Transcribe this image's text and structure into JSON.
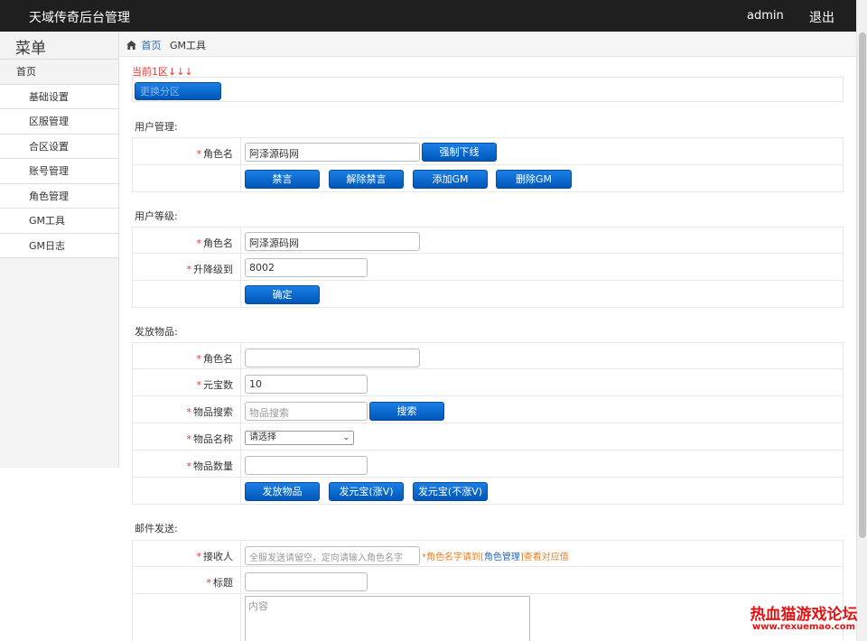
{
  "header": {
    "title": "天域传奇后台管理",
    "user": "admin",
    "logout": "退出"
  },
  "sidebar": {
    "title": "菜单",
    "items": [
      {
        "label": "首页",
        "type": "root"
      },
      {
        "label": "基础设置",
        "type": "sub"
      },
      {
        "label": "区服管理",
        "type": "sub"
      },
      {
        "label": "合区设置",
        "type": "sub"
      },
      {
        "label": "账号管理",
        "type": "sub"
      },
      {
        "label": "角色管理",
        "type": "sub"
      },
      {
        "label": "GM工具",
        "type": "sub"
      },
      {
        "label": "GM日志",
        "type": "sub"
      }
    ]
  },
  "breadcrumb": {
    "home": "首页",
    "current": "GM工具"
  },
  "zone": {
    "current_label": "当前1区",
    "arrows": "↓↓↓",
    "switch_button": "更换分区"
  },
  "user_mgmt": {
    "title": "用户管理:",
    "role_label": "角色名",
    "role_value": "阿泽源码网",
    "kick_button": "强制下线",
    "buttons": {
      "mute": "禁言",
      "unmute": "解除禁言",
      "add_gm": "添加GM",
      "remove_gm": "删除GM"
    }
  },
  "user_level": {
    "title": "用户等级:",
    "role_label": "角色名",
    "role_value": "阿泽源码网",
    "level_label": "升降级到",
    "level_value": "8002",
    "confirm_button": "确定"
  },
  "items": {
    "title": "发放物品:",
    "role_label": "角色名",
    "role_value": "",
    "yuanbao_label": "元宝数",
    "yuanbao_value": "10",
    "search_label": "物品搜索",
    "search_placeholder": "物品搜索",
    "search_button": "搜索",
    "name_label": "物品名称",
    "name_selected": "请选择",
    "count_label": "物品数量",
    "count_value": "",
    "buttons": {
      "send": "发放物品",
      "yb_v": "发元宝(涨V)",
      "yb_nov": "发元宝(不涨V)"
    }
  },
  "mail": {
    "title": "邮件发送:",
    "receiver_label": "接收人",
    "receiver_placeholder": "全服发送请留空，定向请输入角色名字",
    "hint_pre": "*角色名字请到[",
    "hint_link": "角色管理",
    "hint_post": "]查看对应值",
    "subject_label": "标题",
    "subject_value": "",
    "content_placeholder": "内容"
  },
  "watermark": {
    "text": "热血猫游戏论坛",
    "url": "www.rexuemao.com"
  },
  "colors": {
    "topbar": "#1f1f1f",
    "button": "#0a6ad6",
    "required": "#e33333",
    "hint": "#e67e22"
  }
}
